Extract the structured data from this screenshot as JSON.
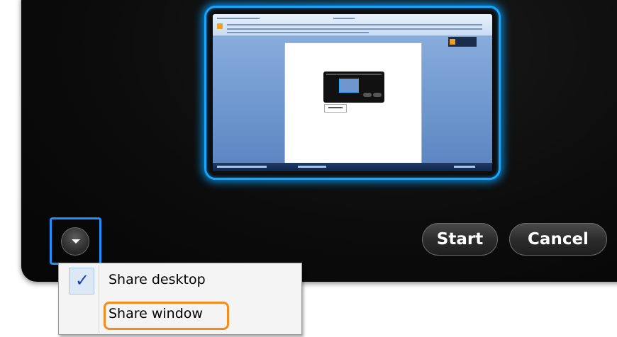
{
  "buttons": {
    "start_label": "Start",
    "cancel_label": "Cancel"
  },
  "dropdown": {
    "icon": "chevron-down-icon"
  },
  "menu": {
    "items": [
      {
        "label": "Share desktop",
        "checked": true,
        "check_glyph": "✓"
      },
      {
        "label": "Share window",
        "checked": false,
        "highlighted": true
      }
    ]
  },
  "colors": {
    "selection_glow": "#19a5ff",
    "highlight_outline": "#f58a1e",
    "dialog_bg": "#0c0c0c"
  }
}
